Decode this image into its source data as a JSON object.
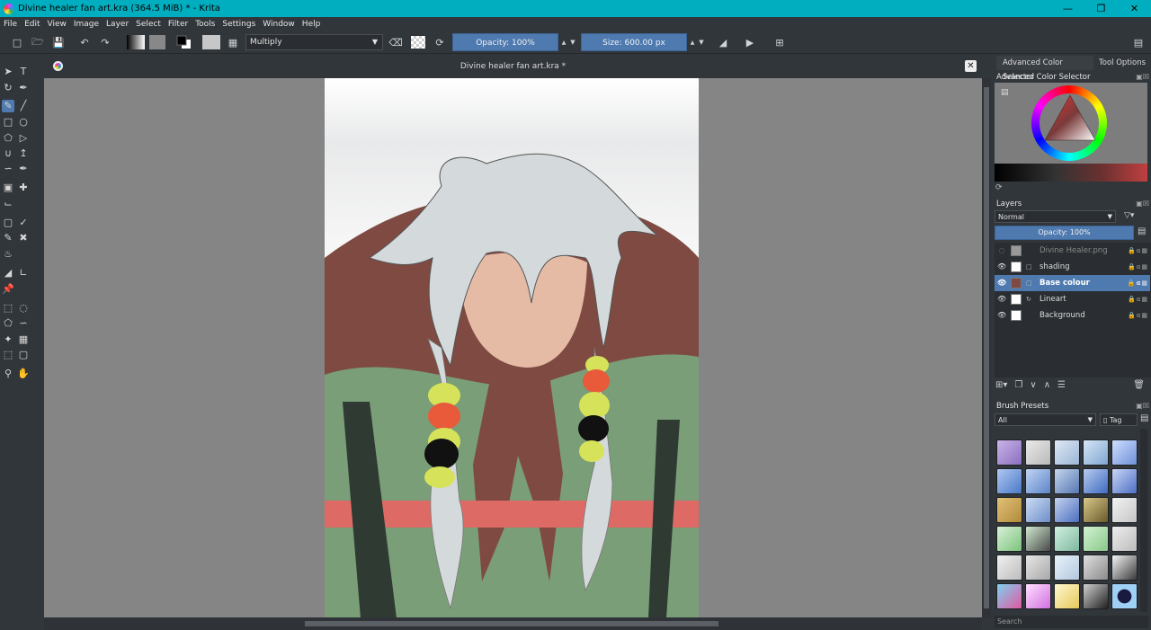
{
  "window": {
    "title": "Divine healer fan art.kra (364.5 MiB)  * - Krita",
    "min": "—",
    "max": "❐",
    "close": "✕"
  },
  "menu": [
    "File",
    "Edit",
    "View",
    "Image",
    "Layer",
    "Select",
    "Filter",
    "Tools",
    "Settings",
    "Window",
    "Help"
  ],
  "toolbar": {
    "blend_mode": "Multiply",
    "opacity": "Opacity: 100%",
    "size": "Size: 600.00 px"
  },
  "document": {
    "tab_title": "Divine healer fan art.kra *"
  },
  "dock": {
    "tabs": [
      "Advanced Color Selector",
      "Tool Options"
    ],
    "color_selector_title": "Advanced Color Selector",
    "layers_title": "Layers",
    "layer_blend": "Normal",
    "layer_opacity": "Opacity:  100%",
    "layers": [
      {
        "name": "Divine Healer.png",
        "visible": false,
        "selected": false
      },
      {
        "name": "shading",
        "visible": true,
        "selected": false
      },
      {
        "name": "Base colour",
        "visible": true,
        "selected": true
      },
      {
        "name": "Lineart",
        "visible": true,
        "selected": false
      },
      {
        "name": "Background",
        "visible": true,
        "selected": false
      }
    ],
    "brush_presets_title": "Brush Presets",
    "brush_filter": "All",
    "tag_label": "Tag",
    "search_placeholder": "Search"
  },
  "colors": {
    "titlebar": "#00aebf",
    "accent": "#4f7ab0",
    "panel": "#31363b",
    "canvas_bg": "#858585"
  }
}
